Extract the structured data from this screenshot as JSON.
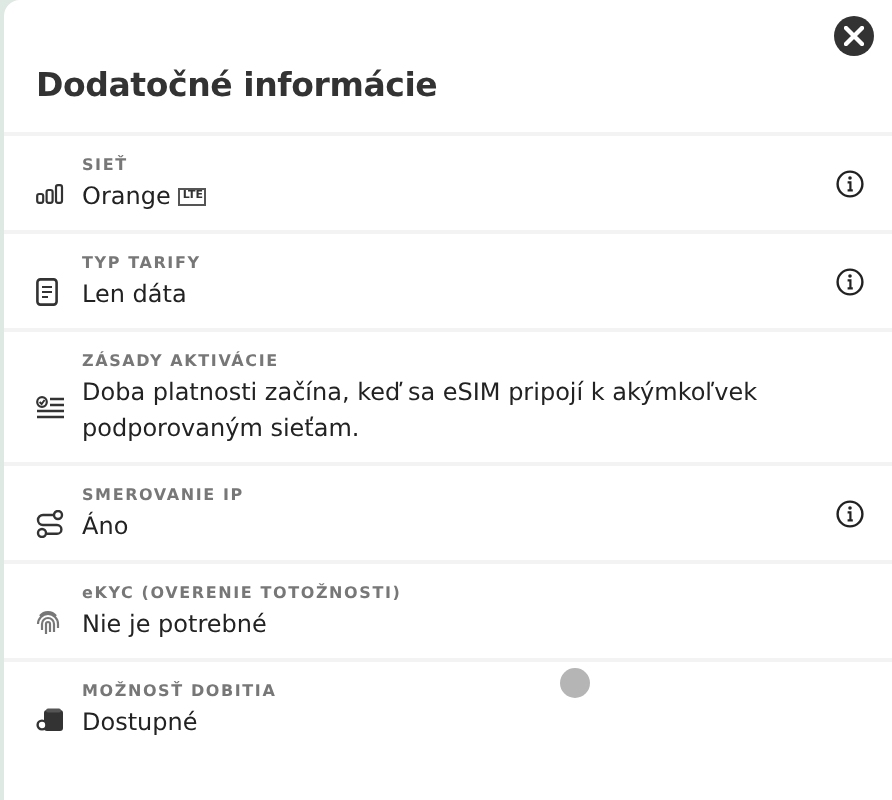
{
  "title": "Dodatočné informácie",
  "rows": [
    {
      "kind": "network",
      "label": "SIEŤ",
      "value": "Orange",
      "badge": "LTE",
      "info": true
    },
    {
      "kind": "plan",
      "label": "TYP TARIFY",
      "value": "Len dáta",
      "info": true
    },
    {
      "kind": "policy",
      "label": "ZÁSADY AKTIVÁCIE",
      "value": "Doba platnosti začína, keď sa eSIM pripojí k akýmkoľvek podporovaným sieťam.",
      "info": false
    },
    {
      "kind": "routing",
      "label": "SMEROVANIE IP",
      "value": "Áno",
      "info": true
    },
    {
      "kind": "ekyc",
      "label": "eKYC (OVERENIE TOTOŽNOSTI)",
      "value": "Nie je potrebné",
      "info": false
    },
    {
      "kind": "topup",
      "label": "MOŽNOSŤ DOBITIA",
      "value": "Dostupné",
      "info": false
    }
  ]
}
